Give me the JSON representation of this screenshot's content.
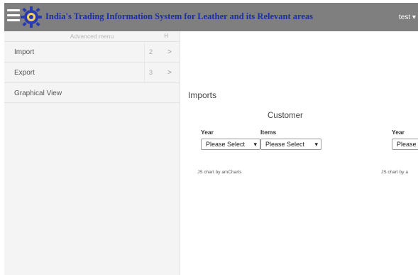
{
  "header": {
    "title": "India's Trading Information System for Leather and its Relevant areas",
    "user_label": "test ▾"
  },
  "sidebar": {
    "header_label": "Advanced menu",
    "collapse_icon": "H",
    "items": [
      {
        "label": "Import",
        "count": "2",
        "chevron": ">"
      },
      {
        "label": "Export",
        "count": "3",
        "chevron": ">"
      },
      {
        "label": "Graphical View"
      }
    ]
  },
  "main": {
    "title": "Imports",
    "subtitle": "Customer",
    "filters": {
      "year_label": "Year",
      "items_label": "Items",
      "year_value": "Please Select",
      "items_value": "Please Select"
    },
    "chart_credit": "JS chart by amCharts",
    "right_panel": {
      "year_label": "Year",
      "year_value": "Please",
      "chart_credit": "JS chart by a"
    }
  },
  "colors": {
    "topbar": "#7f7f7f",
    "title_text": "#1c2fa6",
    "sidebar_bg": "#f4f4f4"
  }
}
